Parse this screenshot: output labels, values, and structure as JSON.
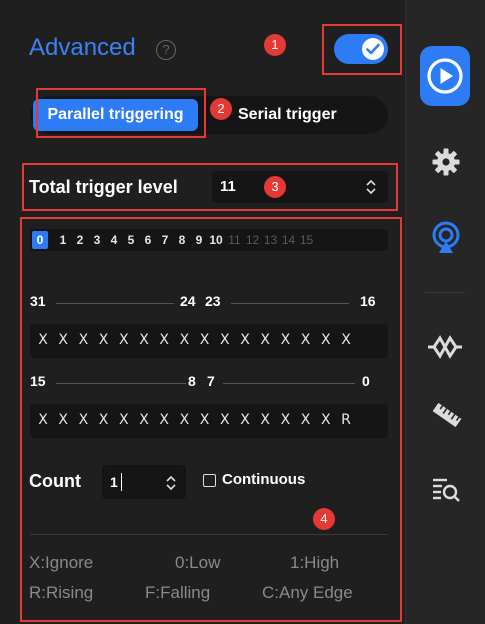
{
  "panel": {
    "title": "Advanced",
    "help_icon": "help-circle-icon",
    "enabled": true,
    "mode_tabs": [
      {
        "label": "Parallel triggering",
        "active": true
      },
      {
        "label": "Serial trigger",
        "active": false
      }
    ],
    "total_trigger_level": {
      "label": "Total trigger level",
      "value": "11"
    },
    "trigger_levels": {
      "items": [
        "0",
        "1",
        "2",
        "3",
        "4",
        "5",
        "6",
        "7",
        "8",
        "9",
        "10",
        "11",
        "12",
        "13",
        "14",
        "15"
      ],
      "selected": "0",
      "enabled_max": 10
    },
    "bits_high": {
      "left_label": "31",
      "mid_left_label": "24",
      "mid_right_label": "23",
      "right_label": "16",
      "values": [
        "X",
        "X",
        "X",
        "X",
        "X",
        "X",
        "X",
        "X",
        "X",
        "X",
        "X",
        "X",
        "X",
        "X",
        "X",
        "X"
      ]
    },
    "bits_low": {
      "left_label": "15",
      "mid_left_label": "8",
      "mid_right_label": "7",
      "right_label": "0",
      "values": [
        "X",
        "X",
        "X",
        "X",
        "X",
        "X",
        "X",
        "X",
        "X",
        "X",
        "X",
        "X",
        "X",
        "X",
        "X",
        "R"
      ]
    },
    "count": {
      "label": "Count",
      "value": "1"
    },
    "continuous": {
      "label": "Continuous",
      "checked": false
    },
    "legend": [
      "X:Ignore",
      "0:Low",
      "1:High",
      "R:Rising",
      "F:Falling",
      "C:Any Edge"
    ]
  },
  "annotations": [
    "1",
    "2",
    "3",
    "4"
  ],
  "sidebar": {
    "icons": [
      "play-icon",
      "settings-gear-icon",
      "signal-antenna-icon",
      "decoder-icon",
      "ruler-icon",
      "search-list-icon"
    ]
  },
  "colors": {
    "accent": "#2d7cf6",
    "annotation": "#e53935",
    "background": "#1f1f1f",
    "legend_text": "#8a8a8a"
  }
}
